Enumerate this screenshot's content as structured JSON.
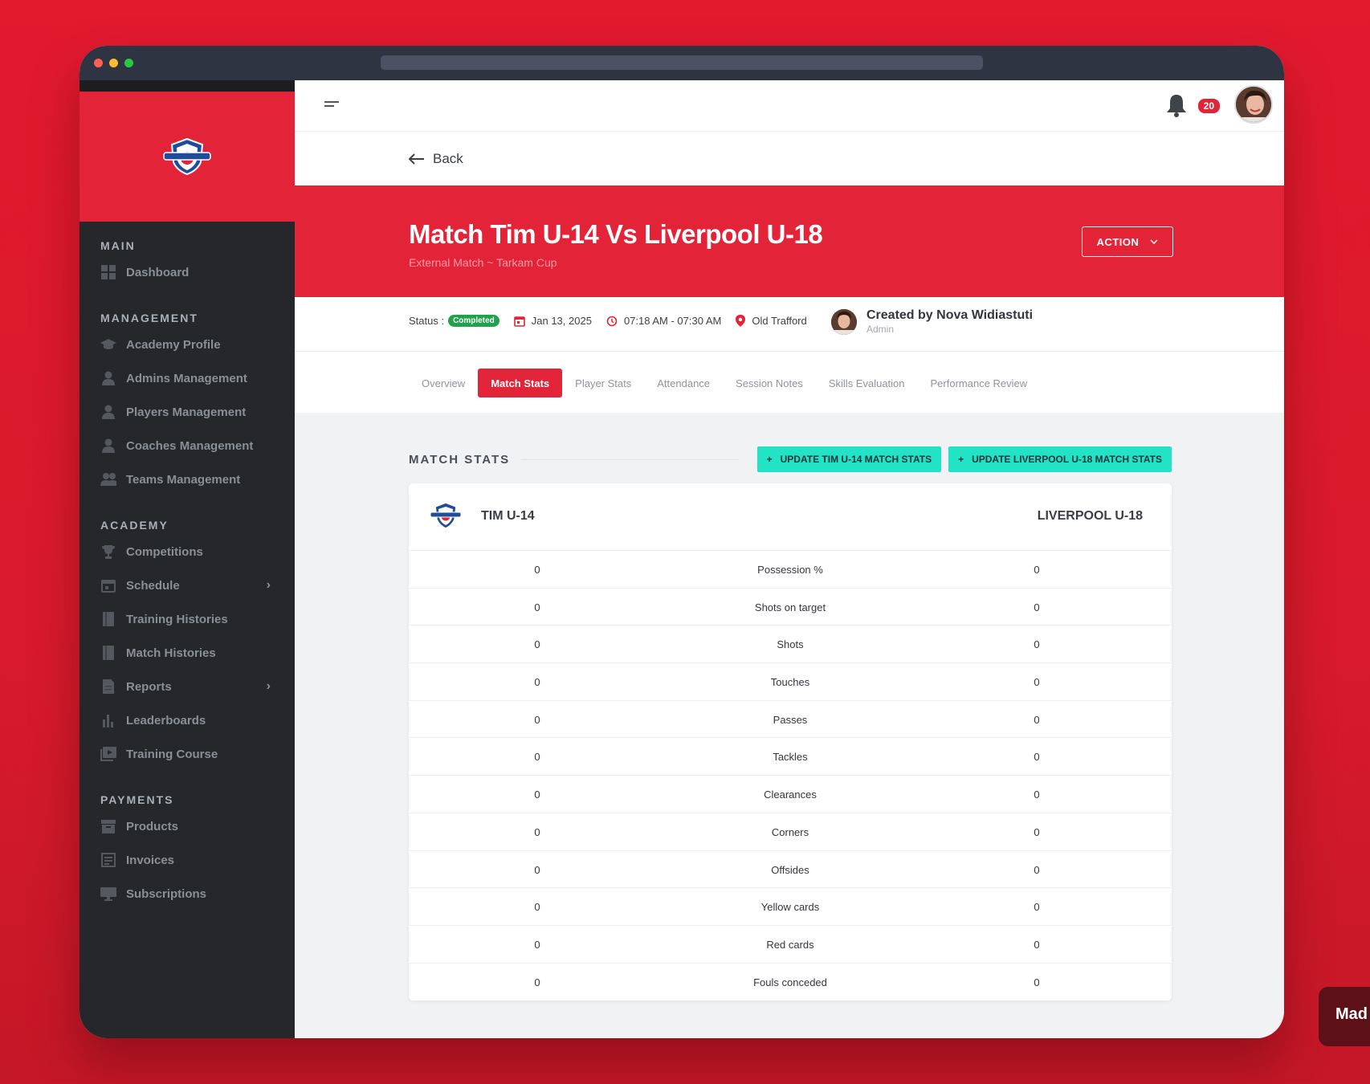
{
  "sidebar": {
    "sections": [
      {
        "title": "MAIN",
        "items": [
          {
            "label": "Dashboard",
            "icon": "dashboard-icon"
          }
        ]
      },
      {
        "title": "MANAGEMENT",
        "items": [
          {
            "label": "Academy Profile",
            "icon": "graduation-cap-icon"
          },
          {
            "label": "Admins Management",
            "icon": "user-icon"
          },
          {
            "label": "Players Management",
            "icon": "user-icon"
          },
          {
            "label": "Coaches Management",
            "icon": "user-icon"
          },
          {
            "label": "Teams Management",
            "icon": "users-icon"
          }
        ]
      },
      {
        "title": "ACADEMY",
        "items": [
          {
            "label": "Competitions",
            "icon": "trophy-icon"
          },
          {
            "label": "Schedule",
            "icon": "calendar-icon",
            "has_children": true
          },
          {
            "label": "Training Histories",
            "icon": "book-icon"
          },
          {
            "label": "Match Histories",
            "icon": "book-icon"
          },
          {
            "label": "Reports",
            "icon": "document-icon",
            "has_children": true
          },
          {
            "label": "Leaderboards",
            "icon": "bar-chart-icon"
          },
          {
            "label": "Training Course",
            "icon": "video-icon"
          }
        ]
      },
      {
        "title": "PAYMENTS",
        "items": [
          {
            "label": "Products",
            "icon": "archive-icon"
          },
          {
            "label": "Invoices",
            "icon": "receipt-icon"
          },
          {
            "label": "Subscriptions",
            "icon": "monitor-icon"
          }
        ]
      }
    ]
  },
  "topbar": {
    "notification_count": "20"
  },
  "back_label": "Back",
  "match": {
    "title": "Match Tim U-14 Vs Liverpool U-18",
    "subtitle": "External Match ~ Tarkam Cup",
    "action_label": "ACTION"
  },
  "meta": {
    "status_label": "Status :",
    "status_value": "Completed",
    "date": "Jan 13, 2025",
    "time": "07:18 AM - 07:30 AM",
    "venue": "Old Trafford",
    "created_by": "Created by Nova Widiastuti",
    "creator_role": "Admin"
  },
  "tabs": [
    {
      "label": "Overview",
      "active": false
    },
    {
      "label": "Match Stats",
      "active": true
    },
    {
      "label": "Player Stats",
      "active": false
    },
    {
      "label": "Attendance",
      "active": false
    },
    {
      "label": "Session Notes",
      "active": false
    },
    {
      "label": "Skills Evaluation",
      "active": false
    },
    {
      "label": "Performance Review",
      "active": false
    }
  ],
  "stats": {
    "title": "MATCH STATS",
    "update_a": "UPDATE TIM U-14 MATCH STATS",
    "update_b": "UPDATE LIVERPOOL U-18 MATCH STATS",
    "team_a": "TIM U-14",
    "team_b": "LIVERPOOL U-18",
    "rows": [
      {
        "a": "0",
        "name": "Possession %",
        "b": "0"
      },
      {
        "a": "0",
        "name": "Shots on target",
        "b": "0"
      },
      {
        "a": "0",
        "name": "Shots",
        "b": "0"
      },
      {
        "a": "0",
        "name": "Touches",
        "b": "0"
      },
      {
        "a": "0",
        "name": "Passes",
        "b": "0"
      },
      {
        "a": "0",
        "name": "Tackles",
        "b": "0"
      },
      {
        "a": "0",
        "name": "Clearances",
        "b": "0"
      },
      {
        "a": "0",
        "name": "Corners",
        "b": "0"
      },
      {
        "a": "0",
        "name": "Offsides",
        "b": "0"
      },
      {
        "a": "0",
        "name": "Yellow cards",
        "b": "0"
      },
      {
        "a": "0",
        "name": "Red cards",
        "b": "0"
      },
      {
        "a": "0",
        "name": "Fouls conceded",
        "b": "0"
      }
    ]
  },
  "made_badge": "Mad",
  "colors": {
    "primary": "#e32337",
    "sidebar": "#25272b",
    "accent_teal": "#22e3c6",
    "status_green": "#1fa34a"
  }
}
